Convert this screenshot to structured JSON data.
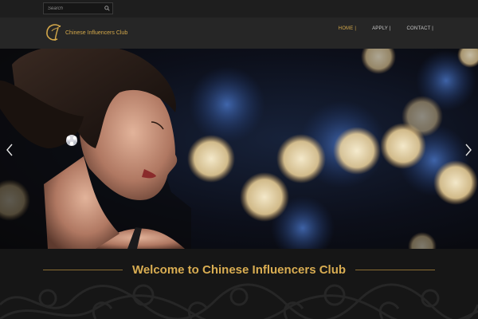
{
  "search": {
    "placeholder": "Search"
  },
  "brand": {
    "name": "Chinese Influencers Club"
  },
  "nav": {
    "items": [
      {
        "label": "HOME |"
      },
      {
        "label": "APPLY |"
      },
      {
        "label": "CONTACT |"
      }
    ]
  },
  "hero": {
    "prev_icon": "chevron-left-icon",
    "next_icon": "chevron-right-icon"
  },
  "welcome": {
    "title": "Welcome to Chinese Influencers Club"
  },
  "colors": {
    "gold": "#d4a84a",
    "header_bg": "#262626",
    "topbar_bg": "#1e1e1e",
    "band_bg": "#161616"
  }
}
